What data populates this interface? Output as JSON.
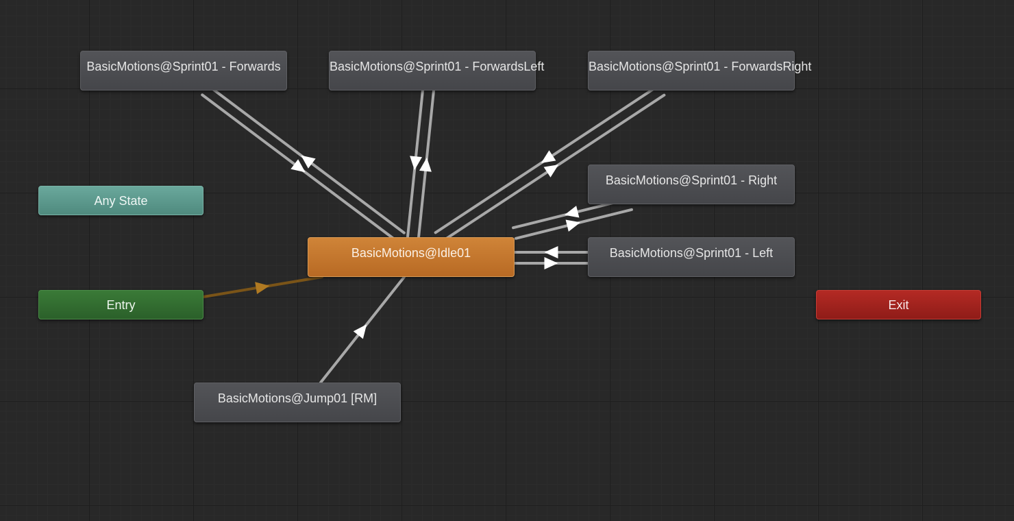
{
  "graph": {
    "any_state": "Any State",
    "entry": "Entry",
    "exit": "Exit",
    "states": {
      "idle": "BasicMotions@Idle01",
      "sprint_forwards": "BasicMotions@Sprint01 - Forwards",
      "sprint_forwards_left": "BasicMotions@Sprint01 - ForwardsLeft",
      "sprint_forwards_right": "BasicMotions@Sprint01 - ForwardsRight",
      "sprint_right": "BasicMotions@Sprint01 - Right",
      "sprint_left": "BasicMotions@Sprint01 - Left",
      "jump": "BasicMotions@Jump01 [RM]"
    },
    "default_state": "idle",
    "transitions": [
      {
        "from": "entry",
        "to": "idle",
        "kind": "default"
      },
      {
        "from": "idle",
        "to": "sprint_forwards"
      },
      {
        "from": "sprint_forwards",
        "to": "idle"
      },
      {
        "from": "idle",
        "to": "sprint_forwards_left"
      },
      {
        "from": "sprint_forwards_left",
        "to": "idle"
      },
      {
        "from": "idle",
        "to": "sprint_forwards_right"
      },
      {
        "from": "sprint_forwards_right",
        "to": "idle"
      },
      {
        "from": "sprint_right",
        "to": "idle"
      },
      {
        "from": "idle",
        "to": "sprint_right"
      },
      {
        "from": "sprint_left",
        "to": "idle"
      },
      {
        "from": "idle",
        "to": "sprint_left"
      },
      {
        "from": "jump",
        "to": "idle"
      }
    ],
    "colors": {
      "default_state": "#c97a2e",
      "any_state": "#5f9d91",
      "entry": "#336e30",
      "exit": "#a3231e",
      "state": "#4a4b4f",
      "transition": "#a8a8a8",
      "default_transition": "#7a5418",
      "default_arrow": "#b07a22"
    }
  }
}
